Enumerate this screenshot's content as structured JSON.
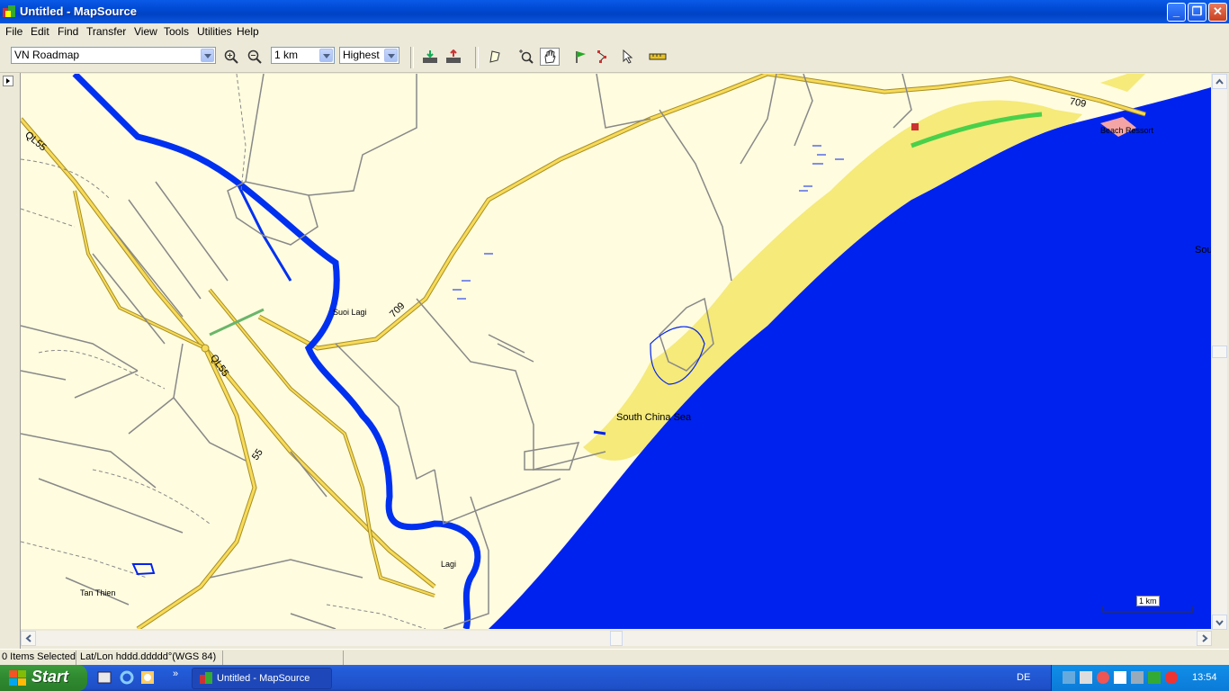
{
  "window": {
    "title": "Untitled - MapSource"
  },
  "menu": [
    "File",
    "Edit",
    "Find",
    "Transfer",
    "View",
    "Tools",
    "Utilities",
    "Help"
  ],
  "toolbar": {
    "map_product": "VN Roadmap",
    "zoom_scale": "1 km",
    "detail_level": "Highest",
    "icons": [
      "zoom-in-icon",
      "zoom-out-icon",
      "receive-from-device-icon",
      "send-to-device-icon",
      "map-tool-icon",
      "zoom-tool-icon",
      "hand-pan-icon",
      "waypoint-tool-icon",
      "route-tool-icon",
      "selection-tool-icon",
      "measure-tool-icon"
    ]
  },
  "map": {
    "labels": {
      "ql55_top": "QL55",
      "ql55_mid": "QL55",
      "r55": "55",
      "r709_mid": "709",
      "r709_top": "709",
      "suoi_lagi": "Suoi Lagi",
      "lagi": "Lagi",
      "tan_thien": "Tan Thien",
      "beach_resort": "Beach Ressort",
      "south_china_sea": "South China Sea",
      "sea_edge": "Sou",
      "scale": "1 km"
    },
    "colors": {
      "land": "#fffcdf",
      "sea": "#0022ee",
      "beach": "#f5ea7a",
      "highway": "#f0d24a",
      "road": "#888888",
      "river": "#0030f0"
    }
  },
  "status": {
    "selected": "0 Items Selected",
    "coords": "Lat/Lon hddd.ddddd°(WGS 84)"
  },
  "taskbar": {
    "start": "Start",
    "task": "Untitled - MapSource",
    "lang": "DE",
    "clock": "13:54"
  }
}
